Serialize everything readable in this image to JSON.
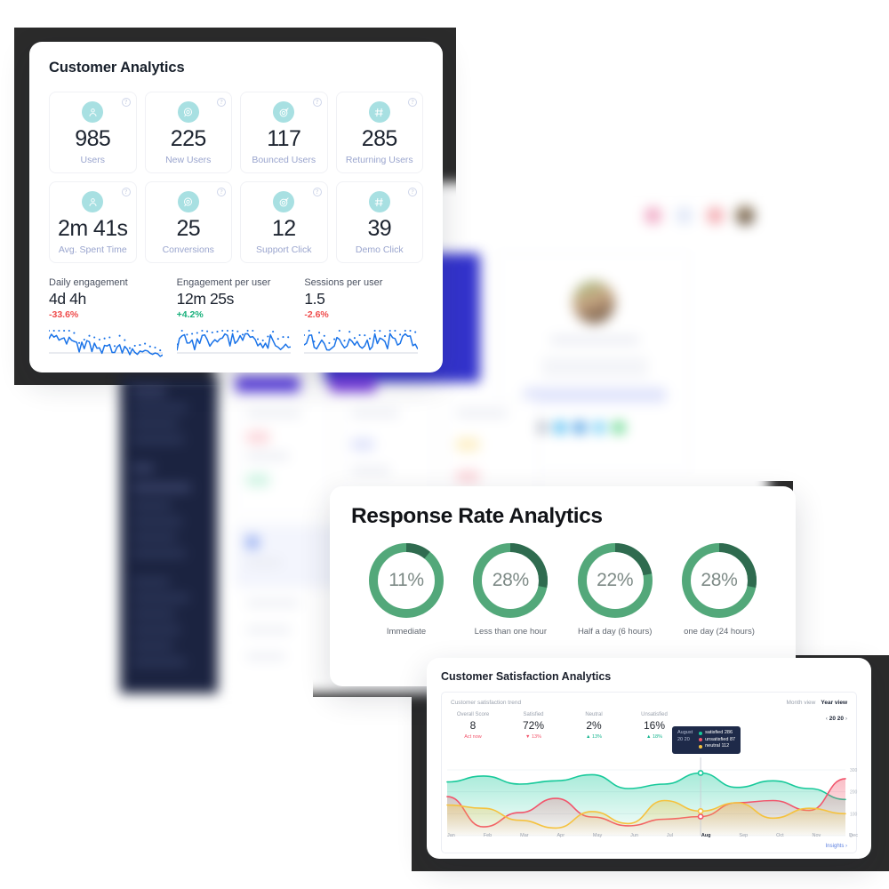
{
  "customer_analytics": {
    "title": "Customer Analytics",
    "help_glyph": "?",
    "kpis": [
      {
        "icon": "user-icon",
        "value": "985",
        "label": "Users"
      },
      {
        "icon": "chat-bubble-icon",
        "value": "225",
        "label": "New Users"
      },
      {
        "icon": "target-icon",
        "value": "117",
        "label": "Bounced Users"
      },
      {
        "icon": "hash-icon",
        "value": "285",
        "label": "Returning Users"
      },
      {
        "icon": "user-icon",
        "value": "2m 41s",
        "label": "Avg. Spent Time"
      },
      {
        "icon": "chat-bubble-icon",
        "value": "25",
        "label": "Conversions"
      },
      {
        "icon": "target-icon",
        "value": "12",
        "label": "Support Click"
      },
      {
        "icon": "hash-icon",
        "value": "39",
        "label": "Demo Click"
      }
    ],
    "sparklines": [
      {
        "title": "Daily engagement",
        "value": "4d 4h",
        "delta": "-33.6%",
        "trend": "down"
      },
      {
        "title": "Engagement per user",
        "value": "12m 25s",
        "delta": "+4.2%",
        "trend": "up"
      },
      {
        "title": "Sessions per user",
        "value": "1.5",
        "delta": "-2.6%",
        "trend": "down"
      }
    ],
    "colors": {
      "icon_bg": "#a8e0e2",
      "label": "#9aa5ce",
      "positive": "#18b07b",
      "negative": "#ef4b4b",
      "spark": "#1a73e8"
    }
  },
  "response_rate": {
    "title": "Response Rate Analytics",
    "colors": {
      "arc_dark": "#2f6b4f",
      "arc_light": "#53a87a"
    },
    "donuts": [
      {
        "value": "11%",
        "pct": 11,
        "label": "Immediate"
      },
      {
        "value": "28%",
        "pct": 28,
        "label": "Less than one hour"
      },
      {
        "value": "22%",
        "pct": 22,
        "label": "Half a day  (6 hours)"
      },
      {
        "value": "28%",
        "pct": 28,
        "label": "one day (24 hours)"
      }
    ]
  },
  "satisfaction": {
    "title": "Customer Satisfaction Analytics",
    "subtitle": "Customer satisfaction trend",
    "view_month": "Month view",
    "view_year": "Year view",
    "year": "20 20",
    "prev_glyph": "‹",
    "next_glyph": "›",
    "stats": [
      {
        "header": "Overall Score",
        "value": "8",
        "delta": "Act now",
        "tone": "red",
        "marker": ""
      },
      {
        "header": "Satisfied",
        "value": "72%",
        "delta": "13%",
        "tone": "red",
        "marker": "▼"
      },
      {
        "header": "Neutral",
        "value": "2%",
        "delta": "13%",
        "tone": "grn",
        "marker": "▲"
      },
      {
        "header": "Unsatisfied",
        "value": "16%",
        "delta": "18%",
        "tone": "grn",
        "marker": "▲"
      }
    ],
    "tooltip": {
      "month": "August",
      "year": "20 20",
      "items": [
        {
          "label": "satisfied 286",
          "color": "#17c99a"
        },
        {
          "label": "unsatisfied 87",
          "color": "#f2546b"
        },
        {
          "label": "neutral 112",
          "color": "#f5c23e"
        }
      ]
    },
    "insights_label": "Insights",
    "insights_glyph": "›",
    "chart_data": {
      "type": "area",
      "title": "Customer satisfaction trend",
      "xlabel": "",
      "ylabel": "",
      "ylim": [
        0,
        300
      ],
      "yticks": [
        0,
        100,
        200,
        300
      ],
      "grid": true,
      "legend_position": "tooltip",
      "categories": [
        "Jan",
        "Feb",
        "Mar",
        "Apr",
        "May",
        "Jun",
        "Jul",
        "Aug",
        "Sep",
        "Oct",
        "Nov",
        "Dec"
      ],
      "highlight_category": "Aug",
      "series": [
        {
          "name": "satisfied",
          "color": "#17c99a",
          "values": [
            245,
            272,
            235,
            250,
            278,
            215,
            235,
            286,
            220,
            250,
            215,
            165
          ]
        },
        {
          "name": "unsatisfied",
          "color": "#f2546b",
          "values": [
            178,
            40,
            105,
            170,
            85,
            45,
            75,
            87,
            150,
            160,
            115,
            260
          ]
        },
        {
          "name": "neutral",
          "color": "#f5c23e",
          "values": [
            140,
            125,
            70,
            35,
            110,
            55,
            160,
            112,
            150,
            80,
            125,
            100
          ]
        }
      ]
    }
  }
}
